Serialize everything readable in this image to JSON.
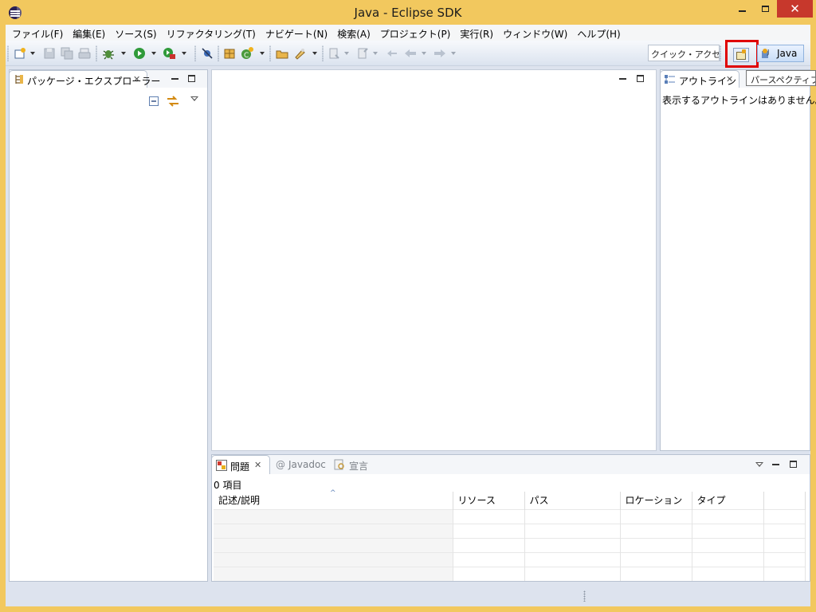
{
  "window": {
    "title": "Java - Eclipse SDK"
  },
  "menu": [
    "ファイル(F)",
    "編集(E)",
    "ソース(S)",
    "リファクタリング(T)",
    "ナビゲート(N)",
    "検索(A)",
    "プロジェクト(P)",
    "実行(R)",
    "ウィンドウ(W)",
    "ヘルプ(H)"
  ],
  "toolbar": {
    "quick_access": "クイック・アクセス",
    "java_perspective": "Java",
    "tooltip": "パースペクティブを"
  },
  "package_explorer": {
    "tab": "パッケージ・エクスプローラー"
  },
  "outline": {
    "tab": "アウトライン",
    "empty_message": "表示するアウトラインはありません。"
  },
  "bottom": {
    "tabs": [
      "問題",
      "Javadoc",
      "宣言"
    ],
    "count": "0 項目",
    "columns": [
      "記述/説明",
      "リソース",
      "パス",
      "ロケーション",
      "タイプ"
    ]
  },
  "colors": {
    "titlebar": "#f2c85e",
    "close_button": "#c7382c",
    "highlight_box": "#e00000",
    "workbench_bg": "#dde3ee"
  }
}
